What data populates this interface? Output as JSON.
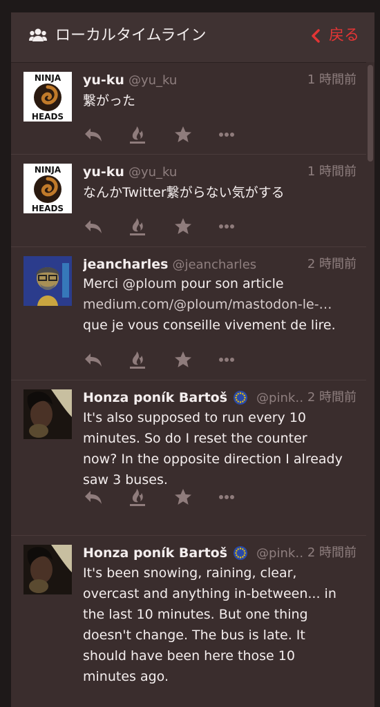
{
  "header": {
    "title": "ローカルタイムライン",
    "back_label": "戻る",
    "icon": "users-icon"
  },
  "statuses": [
    {
      "display_name": "yu-ku",
      "acct": "@yu_ku",
      "time": "1 時間前",
      "avatar_text": [
        "NINJA",
        "HEADS"
      ],
      "content": "繋がった"
    },
    {
      "display_name": "yu-ku",
      "acct": "@yu_ku",
      "time": "1 時間前",
      "avatar_text": [
        "NINJA",
        "HEADS"
      ],
      "content": "なんかTwitter繋がらない気がする"
    },
    {
      "display_name": "jeancharles",
      "acct": "@jeancharles",
      "time": "2 時間前",
      "content_parts": {
        "pre": "Merci ",
        "mention": "@ploum",
        "mid": " pour son article",
        "link": "medium.com/@ploum/mastodon-le-…",
        "post": "que je vous conseille vivement de lire."
      }
    },
    {
      "display_name": "Honza poník Bartoš",
      "acct": "@pink…",
      "time": "2 時間前",
      "content": "It's also supposed to run every 10\nminutes. So do I reset the counter\nnow? In the opposite direction I already\nsaw 3 buses."
    },
    {
      "display_name": "Honza poník Bartoš",
      "acct": "@pink…",
      "time": "2 時間前",
      "content": "It's been snowing, raining, clear,\novercast and anything in-between... in\nthe last 10 minutes. But one thing\ndoesn't change. The bus is late. It\nshould have been here those 10\nminutes ago."
    }
  ],
  "colors": {
    "panel": "#3a2d2d",
    "accent_back": "#e23535",
    "action_icon": "#8f7c7c"
  }
}
